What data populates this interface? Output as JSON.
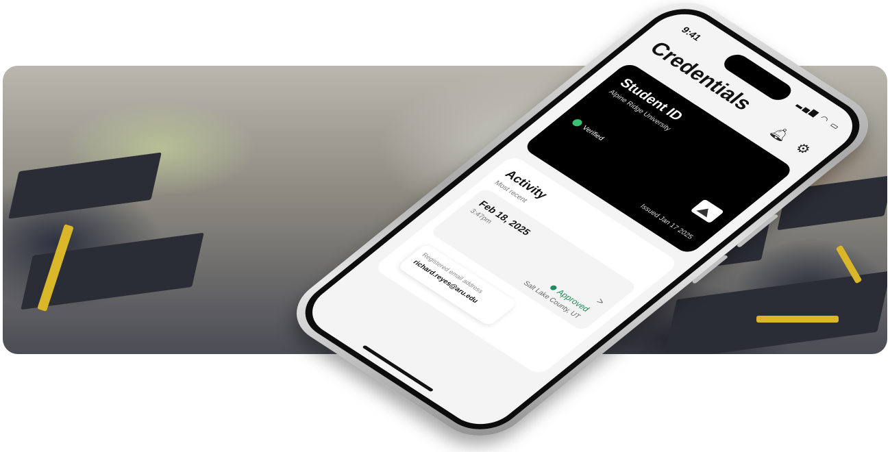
{
  "status": {
    "time": "9:41",
    "icons": "signal wifi battery"
  },
  "header": {
    "title": "Credentials",
    "bell_icon": "bell-icon",
    "settings_icon": "gear-icon"
  },
  "card": {
    "name": "Student ID",
    "org": "Alpine Ridge University",
    "verified": "Verified",
    "issued": "Issued  Jan  17  2025"
  },
  "activity": {
    "title": "Activity",
    "subtitle": "Most recent",
    "item": {
      "date": "Feb 18, 2025",
      "time": "3:47pm",
      "status": "Approved",
      "location": "Salt Lake County, UT"
    },
    "email": {
      "label": "Registered email address",
      "value": "richard.reyes@aru.edu"
    }
  },
  "colors": {
    "approved": "#1f8a5b",
    "verified": "#38c172",
    "card_bg": "#000000"
  }
}
